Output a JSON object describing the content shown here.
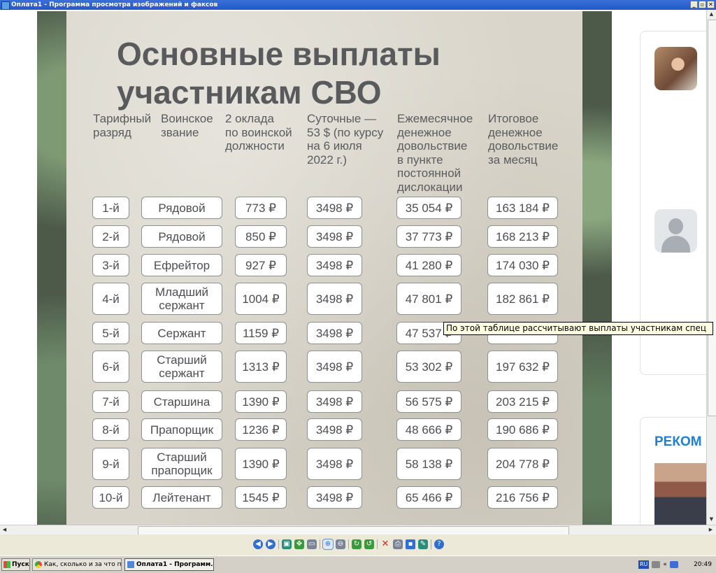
{
  "window": {
    "title": "Оплата1 - Программа просмотра изображений и факсов",
    "buttons": [
      "_",
      "▫",
      "✕"
    ]
  },
  "poster": {
    "headline": "Основные выплаты участникам СВО",
    "columns": [
      "Тарифный\nразряд",
      "Воинское\nзвание",
      "2 оклада\nпо воинской\nдолжности",
      "Суточные —\n53 $ (по курсу\nна 6 июля\n2022 г.)",
      "Ежемесячное\nденежное\nдовольствие\nв пункте\nпостоянной\nдислокации",
      "Итоговое\nденежное\nдовольствие\nза месяц"
    ],
    "rows": [
      {
        "grade": "1-й",
        "rank": "Рядовой",
        "salary": "773 ₽",
        "daily": "3498 ₽",
        "monthly": "35 054 ₽",
        "total": "163 184 ₽"
      },
      {
        "grade": "2-й",
        "rank": "Рядовой",
        "salary": "850 ₽",
        "daily": "3498 ₽",
        "monthly": "37 773 ₽",
        "total": "168 213 ₽"
      },
      {
        "grade": "3-й",
        "rank": "Ефрейтор",
        "salary": "927 ₽",
        "daily": "3498 ₽",
        "monthly": "41 280 ₽",
        "total": "174 030 ₽"
      },
      {
        "grade": "4-й",
        "rank": "Младший\nсержант",
        "salary": "1004 ₽",
        "daily": "3498 ₽",
        "monthly": "47 801 ₽",
        "total": "182 861 ₽"
      },
      {
        "grade": "5-й",
        "rank": "Сержант",
        "salary": "1159 ₽",
        "daily": "3498 ₽",
        "monthly": "47 537 ₽",
        "total": ""
      },
      {
        "grade": "6-й",
        "rank": "Старший\nсержант",
        "salary": "1313 ₽",
        "daily": "3498 ₽",
        "monthly": "53 302 ₽",
        "total": "197 632 ₽"
      },
      {
        "grade": "7-й",
        "rank": "Старшина",
        "salary": "1390 ₽",
        "daily": "3498 ₽",
        "monthly": "56 575 ₽",
        "total": "203 215 ₽"
      },
      {
        "grade": "8-й",
        "rank": "Прапорщик",
        "salary": "1236 ₽",
        "daily": "3498 ₽",
        "monthly": "48 666 ₽",
        "total": "190 686 ₽"
      },
      {
        "grade": "9-й",
        "rank": "Старший\nпрапорщик",
        "salary": "1390 ₽",
        "daily": "3498 ₽",
        "monthly": "58 138 ₽",
        "total": "204 778 ₽"
      },
      {
        "grade": "10-й",
        "rank": "Лейтенант",
        "salary": "1545 ₽",
        "daily": "3498 ₽",
        "monthly": "65 466 ₽",
        "total": "216 756 ₽"
      }
    ]
  },
  "tooltip": "По этой таблице рассчитывают выплаты участникам спец",
  "sidebar": {
    "section_title": "РЕКОМ"
  },
  "toolbar": {
    "icons": [
      "previous-icon",
      "next-icon",
      "best-fit-icon",
      "actual-size-icon",
      "slideshow-icon",
      "zoom-in-icon",
      "zoom-out-icon",
      "rotate-clockwise-icon",
      "rotate-counterclockwise-icon",
      "delete-icon",
      "print-icon",
      "save-icon",
      "open-in-editor-icon",
      "help-icon"
    ]
  },
  "taskbar": {
    "start_label": "Пуск",
    "tasks": [
      {
        "label": "Как, сколько и за что п...",
        "icon": "chrome-icon"
      },
      {
        "label": "Оплата1 - Программ...",
        "icon": "image-viewer-icon",
        "active": true
      }
    ],
    "language": "RU",
    "clock": "20:49"
  }
}
